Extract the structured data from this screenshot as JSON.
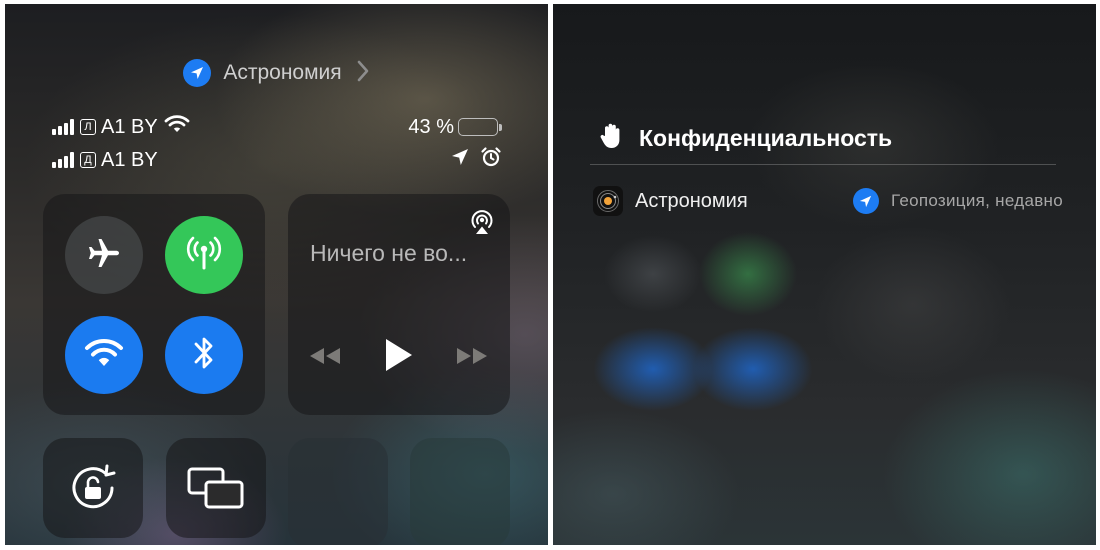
{
  "left": {
    "location_banner": {
      "app_name": "Астрономия",
      "icon": "location-arrow-icon",
      "chevron": "chevron-right-icon"
    },
    "status": {
      "sim1": {
        "badge": "Л",
        "carrier": "A1 BY"
      },
      "sim2": {
        "badge": "Д",
        "carrier": "A1 BY"
      },
      "battery_percent_text": "43 %",
      "battery_level": 0.43,
      "icons": [
        "signal-bars-icon",
        "wifi-icon",
        "battery-icon",
        "location-arrow-icon",
        "alarm-clock-icon"
      ]
    },
    "connectivity": [
      {
        "name": "airplane-mode",
        "icon": "airplane-icon",
        "state": "off",
        "color": "#46484a"
      },
      {
        "name": "cellular-data",
        "icon": "antenna-icon",
        "state": "on",
        "color": "#34c759"
      },
      {
        "name": "wifi",
        "icon": "wifi-icon",
        "state": "on",
        "color": "#1b7bf0"
      },
      {
        "name": "bluetooth",
        "icon": "bluetooth-icon",
        "state": "on",
        "color": "#1b7bf0"
      }
    ],
    "now_playing": {
      "title": "Ничего не во...",
      "icons": [
        "airplay-audio-icon",
        "rewind-icon",
        "play-icon",
        "fast-forward-icon"
      ]
    },
    "bottom_controls": [
      {
        "name": "orientation-lock",
        "icon": "rotation-lock-icon"
      },
      {
        "name": "screen-mirroring",
        "icon": "screen-mirroring-icon"
      }
    ]
  },
  "right": {
    "privacy": {
      "title": "Конфиденциальность",
      "icon": "raised-hand-icon",
      "entries": [
        {
          "app": "Астрономия",
          "app_icon": "astronomy-app-icon",
          "usage": "Геопозиция, недавно",
          "usage_icon": "location-arrow-icon"
        }
      ]
    }
  },
  "colors": {
    "accent_blue": "#1d7cf3",
    "accent_green": "#34c759"
  }
}
